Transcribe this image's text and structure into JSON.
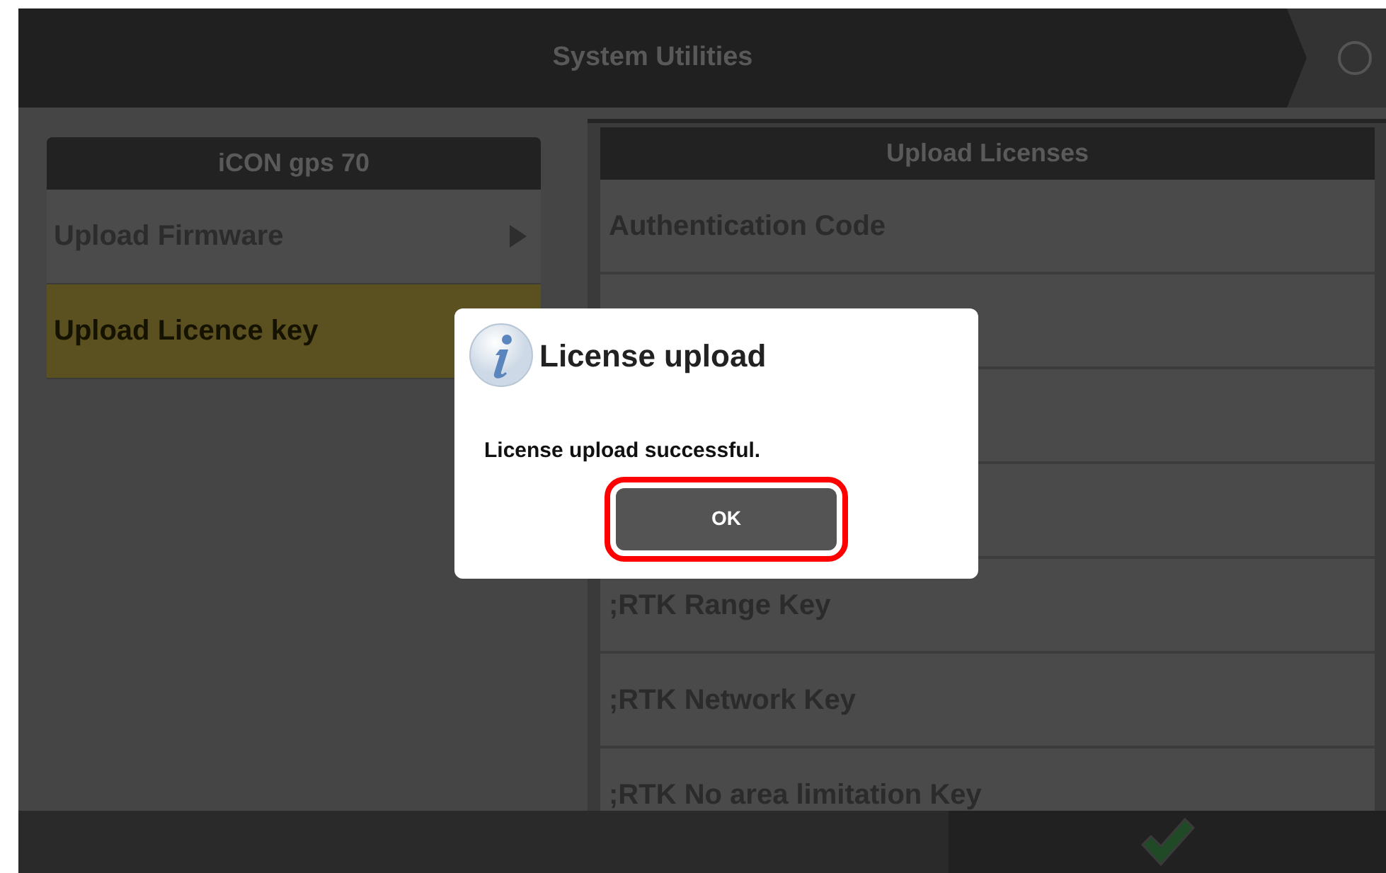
{
  "header": {
    "title": "System Utilities"
  },
  "device_panel": {
    "title": "iCON gps 70",
    "items": [
      {
        "kind": "submenu",
        "label": "Upload Firmware",
        "selected": false
      },
      {
        "kind": "command",
        "label": "Upload Licence key",
        "selected": true
      }
    ]
  },
  "licenses_panel": {
    "title": "Upload Licenses",
    "items": [
      {
        "kind": "license",
        "label": "Authentication Code"
      },
      {
        "kind": "covered"
      },
      {
        "kind": "covered"
      },
      {
        "kind": "covered"
      },
      {
        "kind": "license",
        "label": ";RTK Range Key"
      },
      {
        "kind": "license",
        "label": ";RTK Network Key"
      },
      {
        "kind": "license",
        "label": ";RTK No area limitation Key"
      }
    ]
  },
  "dialog": {
    "title": "License upload",
    "message": "License upload successful.",
    "button": {
      "label": "OK",
      "highlighted": true
    }
  },
  "footer": {
    "confirm_enabled": true
  }
}
